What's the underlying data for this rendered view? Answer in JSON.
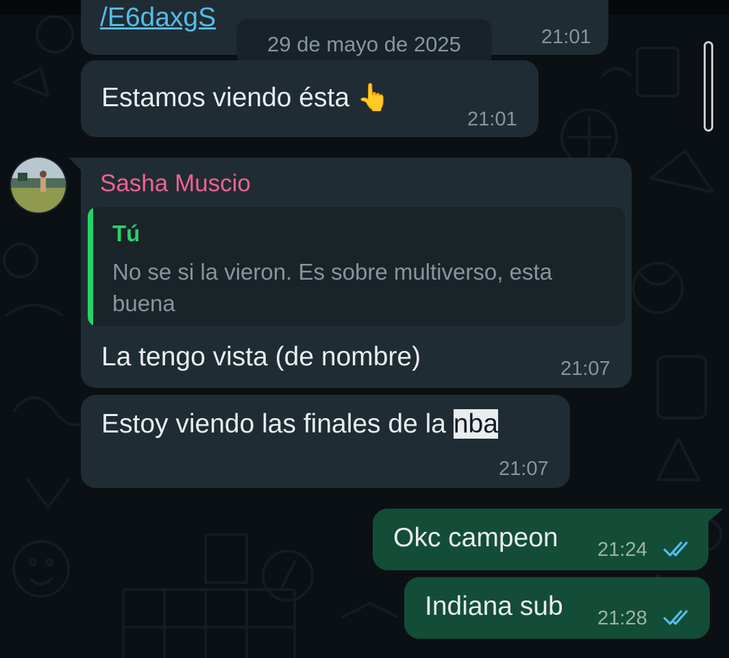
{
  "date_pill": "29 de mayo de 2025",
  "messages": {
    "link_partial": "/E6daxgS",
    "link_time": "21:01",
    "m1": {
      "text": "Estamos viendo ésta",
      "emoji": "👆",
      "time": "21:01"
    },
    "m2": {
      "sender": "Sasha Muscio",
      "quote_author": "Tú",
      "quote_text": "No se si la vieron. Es sobre multiverso, esta buena",
      "text": "La tengo vista (de nombre)",
      "time": "21:07"
    },
    "m3": {
      "text_before": "Estoy viendo las finales de la ",
      "text_highlight": "nba",
      "time": "21:07"
    },
    "m4": {
      "text": "Okc campeon",
      "time": "21:24"
    },
    "m5": {
      "text": "Indiana sub",
      "time": "21:28"
    }
  },
  "icons": {
    "read_receipt": "double-check-icon",
    "avatar": "contact-avatar"
  },
  "colors": {
    "background": "#0b1014",
    "incoming_bubble": "#202c33",
    "outgoing_bubble": "#134d37",
    "link": "#53bdeb",
    "sender_name": "#f06292",
    "quote_accent": "#25d366",
    "read_ticks": "#53bdeb"
  }
}
